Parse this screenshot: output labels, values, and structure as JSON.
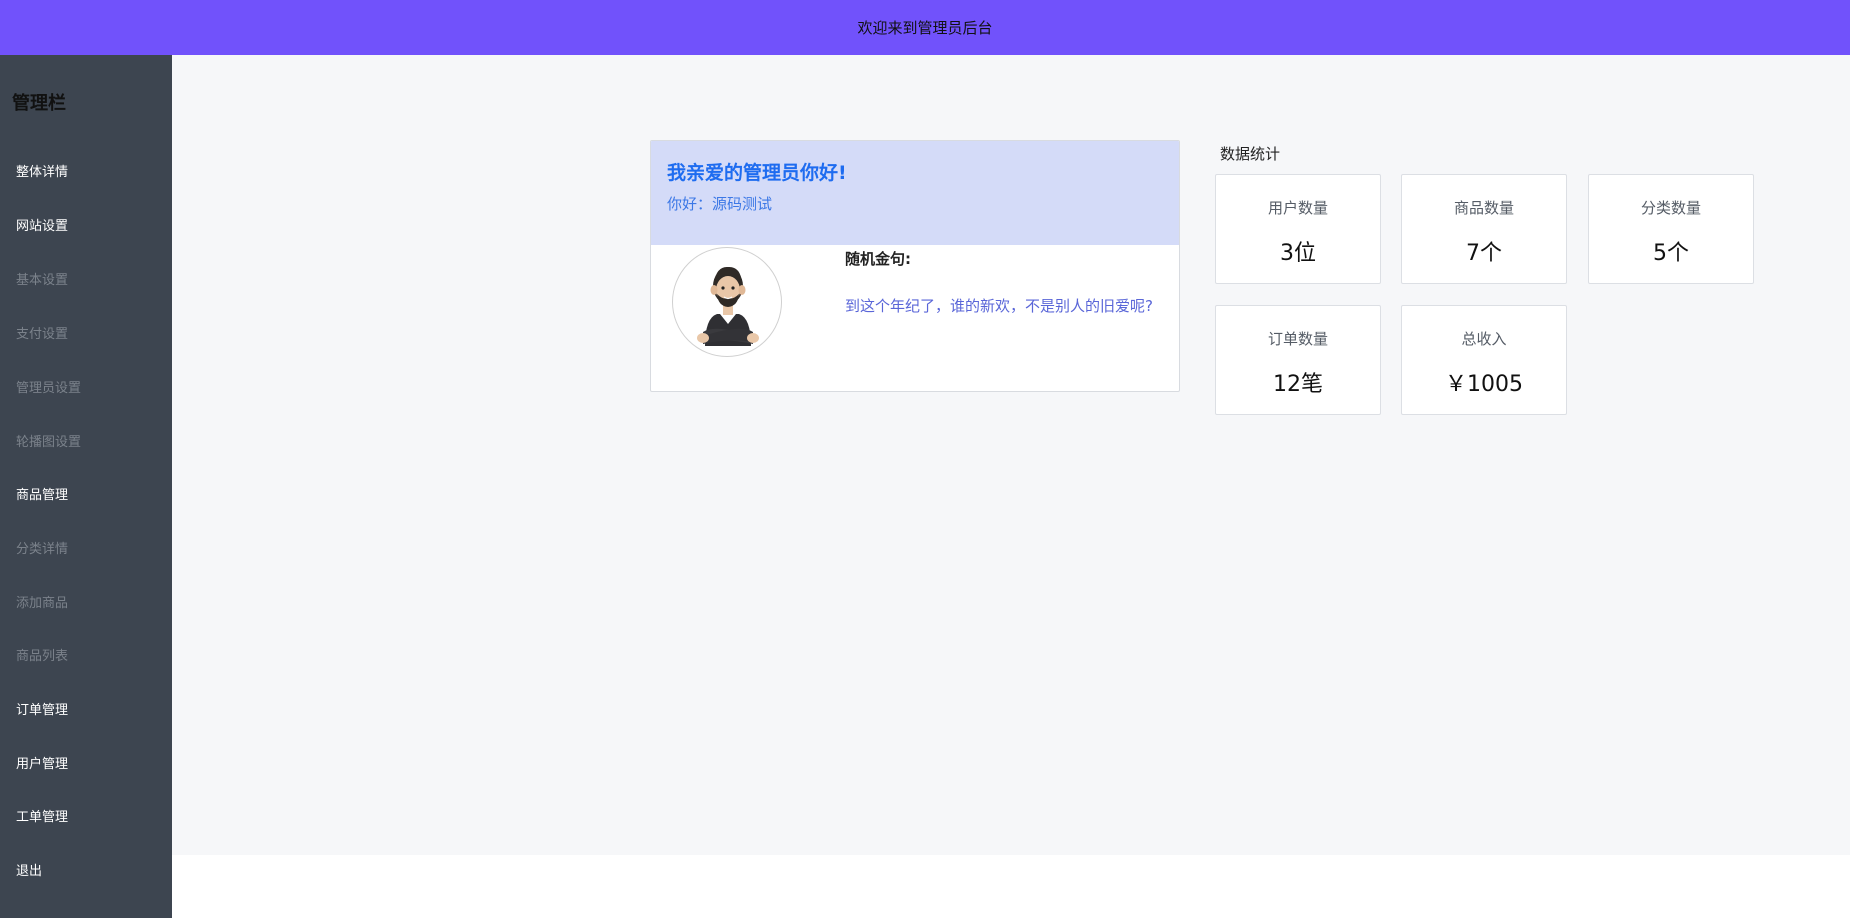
{
  "header": {
    "title": "欢迎来到管理员后台"
  },
  "sidebar": {
    "title": "管理栏",
    "items": [
      {
        "label": "整体详情",
        "level": "primary"
      },
      {
        "label": "网站设置",
        "level": "primary"
      },
      {
        "label": "基本设置",
        "level": "secondary"
      },
      {
        "label": "支付设置",
        "level": "secondary"
      },
      {
        "label": "管理员设置",
        "level": "secondary"
      },
      {
        "label": "轮播图设置",
        "level": "secondary"
      },
      {
        "label": "商品管理",
        "level": "primary"
      },
      {
        "label": "分类详情",
        "level": "secondary"
      },
      {
        "label": "添加商品",
        "level": "secondary"
      },
      {
        "label": "商品列表",
        "level": "secondary"
      },
      {
        "label": "订单管理",
        "level": "primary"
      },
      {
        "label": "用户管理",
        "level": "primary"
      },
      {
        "label": "工单管理",
        "level": "primary"
      },
      {
        "label": "退出",
        "level": "primary"
      }
    ]
  },
  "welcome": {
    "title": "我亲爱的管理员你好!",
    "subtitle": "你好：源码测试",
    "avatar_icon": "cartoon-man-avatar",
    "quote_label": "随机金句:",
    "quote_text": "到这个年纪了，谁的新欢，不是别人的旧爱呢?"
  },
  "stats": {
    "title": "数据统计",
    "cards": [
      {
        "label": "用户数量",
        "value": "3位"
      },
      {
        "label": "商品数量",
        "value": "7个"
      },
      {
        "label": "分类数量",
        "value": "5个"
      },
      {
        "label": "订单数量",
        "value": "12笔"
      },
      {
        "label": "总收入",
        "value": "￥1005"
      }
    ]
  },
  "colors": {
    "header_bg": "#7152fb",
    "sidebar_bg": "#3d4550",
    "greet_blue": "#1e6cf0",
    "quote_color": "#5a66d8"
  }
}
